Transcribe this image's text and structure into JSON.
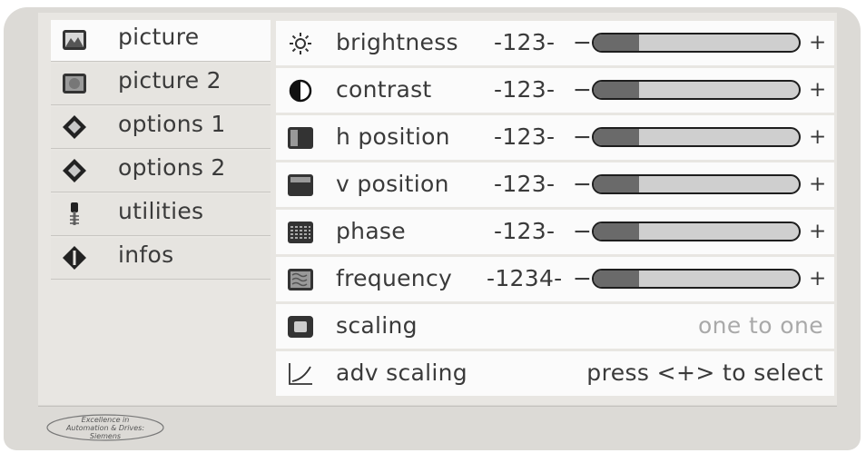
{
  "sidebar": {
    "items": [
      {
        "label": "picture",
        "icon": "landscape-picture-icon",
        "active": true
      },
      {
        "label": "picture 2",
        "icon": "picture-2-icon"
      },
      {
        "label": "options 1",
        "icon": "diamond-options-icon"
      },
      {
        "label": "options 2",
        "icon": "diamond-options-icon"
      },
      {
        "label": "utilities",
        "icon": "wrench-utilities-icon"
      },
      {
        "label": "infos",
        "icon": "info-icon"
      }
    ]
  },
  "settings": {
    "rows": [
      {
        "label": "brightness",
        "value": "-123-",
        "minus": "−",
        "plus": "+",
        "level": 0.22,
        "icon": "sun-icon"
      },
      {
        "label": "contrast",
        "value": "-123-",
        "minus": "−",
        "plus": "+",
        "level": 0.22,
        "icon": "contrast-icon"
      },
      {
        "label": "h position",
        "value": "-123-",
        "minus": "−",
        "plus": "+",
        "level": 0.22,
        "icon": "h-position-icon"
      },
      {
        "label": "v position",
        "value": "-123-",
        "minus": "−",
        "plus": "+",
        "level": 0.22,
        "icon": "v-position-icon"
      },
      {
        "label": "phase",
        "value": "-123-",
        "minus": "−",
        "plus": "+",
        "level": 0.22,
        "icon": "phase-icon"
      },
      {
        "label": "frequency",
        "value": "-1234-",
        "minus": "−",
        "plus": "+",
        "level": 0.22,
        "icon": "frequency-icon"
      },
      {
        "label": "scaling",
        "status": "one to one",
        "icon": "scaling-icon"
      },
      {
        "label": "adv scaling",
        "status": "press <+> to select",
        "icon": "adv-scaling-curve-icon"
      }
    ]
  },
  "logo": {
    "line1": "Excellence in",
    "line2": "Automation & Drives:",
    "line3": "Siemens"
  }
}
